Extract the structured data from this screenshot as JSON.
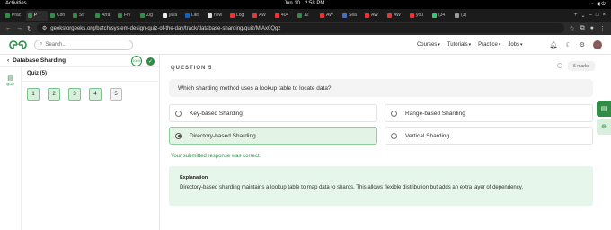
{
  "os": {
    "menu": "Activities",
    "date": "Jun 10",
    "time": "2:58 PM"
  },
  "tabs": [
    {
      "label": "Prac",
      "color": "#2f8d46",
      "active": false
    },
    {
      "label": "P",
      "color": "#2f8d46",
      "active": true
    },
    {
      "label": "Con",
      "color": "#2f8d46",
      "active": false
    },
    {
      "label": "Str",
      "color": "#2f8d46",
      "active": false
    },
    {
      "label": "Arra",
      "color": "#2f8d46",
      "active": false
    },
    {
      "label": "Fin",
      "color": "#2f8d46",
      "active": false
    },
    {
      "label": "Zig",
      "color": "#2f8d46",
      "active": false
    },
    {
      "label": "java",
      "color": "#eeeeee",
      "active": false
    },
    {
      "label": "Likt",
      "color": "#0a66c2",
      "active": false
    },
    {
      "label": "new",
      "color": "#dddddd",
      "active": false
    },
    {
      "label": "Log",
      "color": "#e33",
      "active": false
    },
    {
      "label": "AW",
      "color": "#e33",
      "active": false
    },
    {
      "label": "404",
      "color": "#e33",
      "active": false
    },
    {
      "label": "12",
      "color": "#2f8d46",
      "active": false
    },
    {
      "label": "AW",
      "color": "#e33",
      "active": false
    },
    {
      "label": "Sea",
      "color": "#3a6fd8",
      "active": false
    },
    {
      "label": "AW",
      "color": "#e33",
      "active": false
    },
    {
      "label": "AW",
      "color": "#e33",
      "active": false
    },
    {
      "label": "you",
      "color": "#e33",
      "active": false
    },
    {
      "label": "(34",
      "color": "#25d366",
      "active": false
    },
    {
      "label": "(3)",
      "color": "#999999",
      "active": false
    }
  ],
  "address": {
    "url": "geeksforgeeks.org/batch/system-design-quiz-of-the-day/track/database-sharding/quiz/MjAx0Qgz"
  },
  "header": {
    "search_placeholder": "Search...",
    "nav": [
      "Courses",
      "Tutorials",
      "Practice",
      "Jobs"
    ]
  },
  "sidebar": {
    "course_title": "Database Sharding",
    "progress": "100%",
    "rail_label": "Quiz",
    "quiz_label": "Quiz (5)",
    "questions": [
      "1",
      "2",
      "3",
      "4",
      "5"
    ]
  },
  "question": {
    "label": "QUESTION 5",
    "marks": "5 marks",
    "text": "Which sharding method uses a lookup table to locate data?",
    "options": [
      "Key-based Sharding",
      "Range-based Sharding",
      "Directory-based Sharding",
      "Vertical Sharding"
    ],
    "selected_index": 2,
    "feedback": "Your submitted response was correct.",
    "explanation_title": "Explanation",
    "explanation_text": "Directory-based sharding maintains a lookup table to map data to shards. This allows flexible distribution but adds an extra layer of dependency."
  },
  "colors": {
    "brand": "#2f8d46",
    "selected_bg": "#e3f4e6",
    "explain_bg": "#e7f6ea"
  }
}
